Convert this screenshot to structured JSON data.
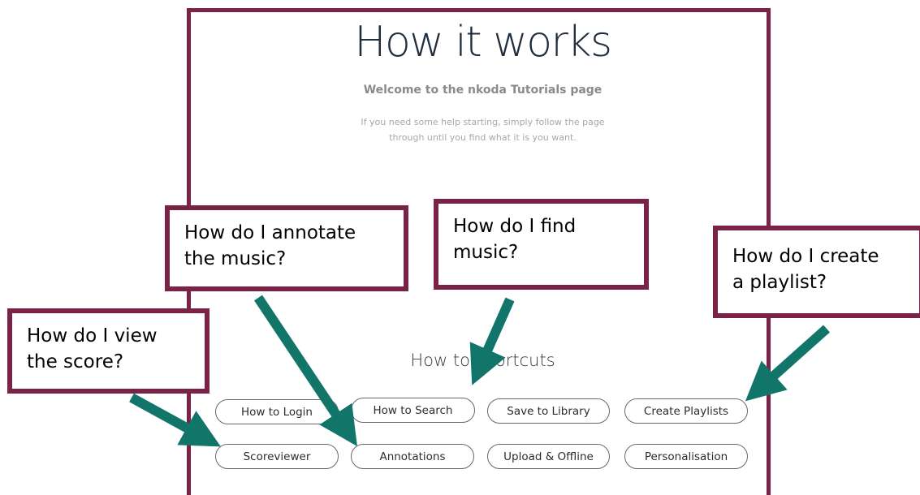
{
  "page": {
    "title": "How it works",
    "welcome": "Welcome to the nkoda Tutorials page",
    "intro_line1": "If you need some help starting, simply follow the page",
    "intro_line2": "through until you find what it is you want.",
    "shortcuts_title": "How to shortcuts"
  },
  "shortcuts": {
    "login": "How to Login",
    "search": "How to Search",
    "save": "Save to Library",
    "playlists": "Create Playlists",
    "scoreviewer": "Scoreviewer",
    "annotations": "Annotations",
    "upload": "Upload & Offline",
    "personalisation": "Personalisation"
  },
  "callouts": {
    "annotate_1": "How do I annotate",
    "annotate_2": "the music?",
    "find_1": "How do I find",
    "find_2": "music?",
    "playlist_1": "How do I create",
    "playlist_2": "a playlist?",
    "score_1": "How do I view",
    "score_2": "the score?"
  },
  "colors": {
    "frame": "#7b2346",
    "arrow": "#12756a"
  }
}
